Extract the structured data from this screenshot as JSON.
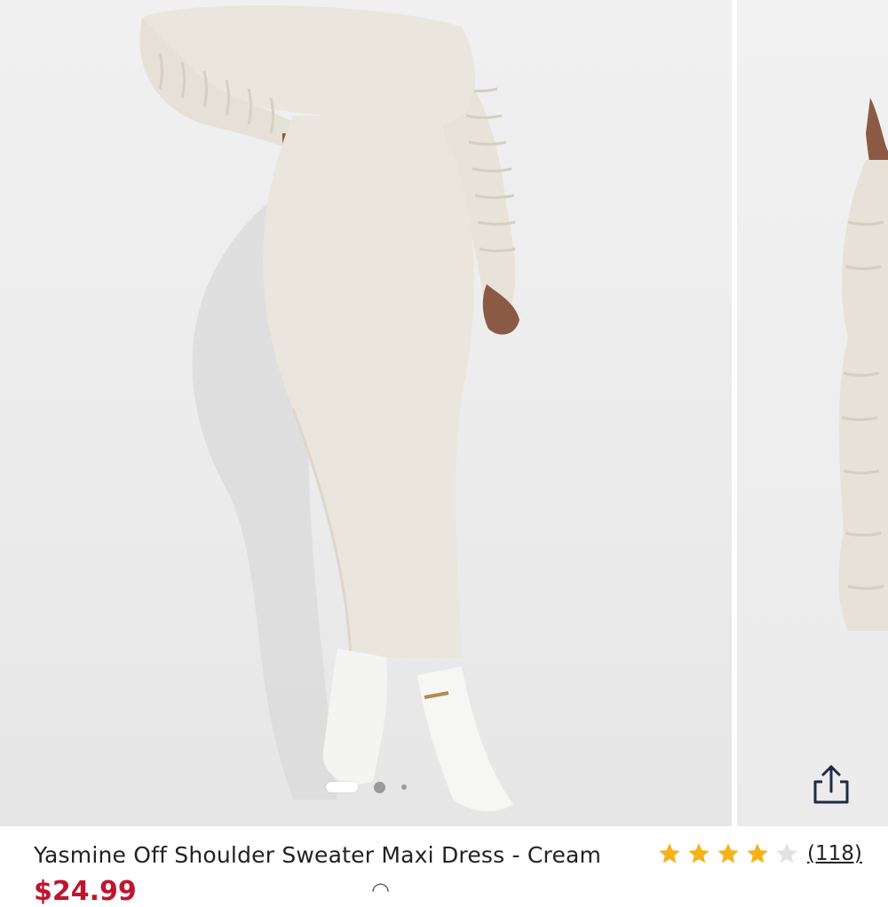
{
  "product": {
    "title": "Yasmine Off Shoulder Sweater Maxi Dress - Cream",
    "rating": 4,
    "rating_max": 5,
    "review_count": "(118)",
    "price_fragment": "$24.99"
  },
  "gallery": {
    "current_index": 0,
    "total": 3
  },
  "icons": {
    "share": "share-icon",
    "star": "star-icon"
  },
  "colors": {
    "star_filled": "#f5b21a",
    "star_empty": "#e3e3e3",
    "price": "#c0152f",
    "garment": "#e9e4dc"
  }
}
